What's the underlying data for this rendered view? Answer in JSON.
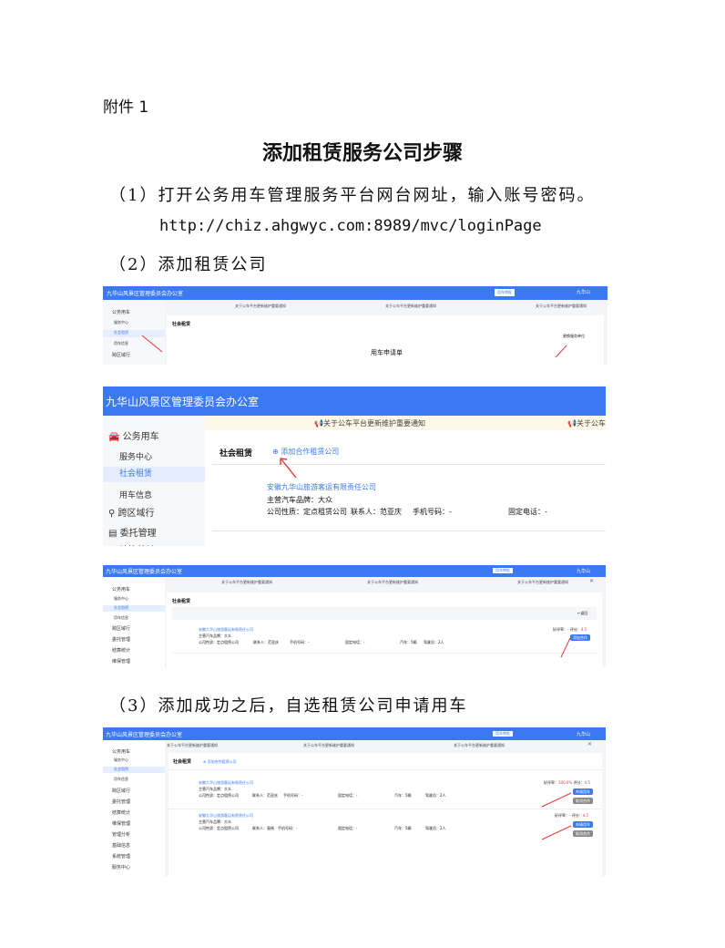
{
  "attachment": "附件 1",
  "title": "添加租赁服务公司步骤",
  "step1": "（1）打开公务用车管理服务平台网台网址，输入账号密码。",
  "step1_url": "http://chiz.ahgwyc.com:8989/mvc/loginPage",
  "step2": "（2）添加租赁公司",
  "step3": "（3）添加成功之后，自选租赁公司申请用车",
  "app": {
    "org_name": "九华山风景区管理委员会办公室",
    "notice": "关于公车平台更新维护重要通知",
    "menu": {
      "official": "公务用车",
      "service_center": "服务中心",
      "social_rental": "社会租赁",
      "car_info": "用车信息",
      "cross_region": "跨区域行",
      "entrust": "委托管理",
      "settle": "结算统计",
      "maintain": "维保管理",
      "manage_analysis": "管理分析",
      "basic_info": "基础信息",
      "system": "系统管理",
      "service_center2": "服务中心"
    },
    "header_right": {
      "apply_btn": "用车审批",
      "user": "九华山"
    },
    "social_rental_title": "社会租赁",
    "add_partner": "添加合作租赁公司",
    "apply_form": "用车申请单",
    "change_service": "更换服务单位",
    "return_label": "返回",
    "company": {
      "name": "安徽九华山旅游客运有限责任公司",
      "brand": "主营汽车品牌：大众",
      "nature": "公司性质：定点租赁公司",
      "contact": "联系人：范亚庆",
      "phone": "手机号码：-",
      "fixed_phone": "固定电话：-",
      "cars": "汽车：5辆",
      "drivers": "驾驶员：2人"
    },
    "company2": {
      "name": "安徽九华山旅游客运有限责任公司",
      "brand": "主营汽车品牌：大众",
      "nature": "公司性质：定点租赁公司",
      "contact": "联系人：袁杨",
      "phone": "手机号码：-",
      "fixed_phone": "固定电话：-",
      "cars": "汽车：5辆",
      "drivers": "驾驶员：2人"
    },
    "rate_label": "好评率：",
    "rate_value": "100.0%",
    "score_label": "评分：",
    "score_value": "4.5",
    "rate_dash": "-",
    "btn_add_partner": "添加合作",
    "btn_apply": "申请用车",
    "btn_cancel": "取消合作"
  },
  "colors": {
    "header": "#3b79f3",
    "arrow": "#e23b3b"
  }
}
